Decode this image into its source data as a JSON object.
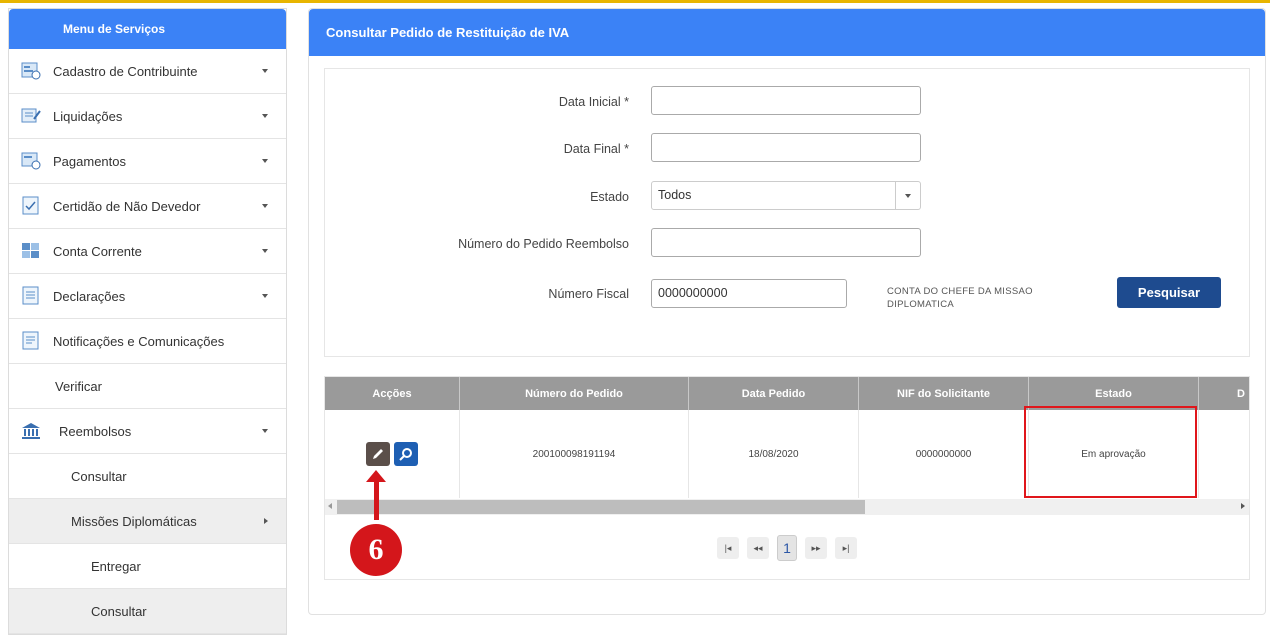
{
  "sidebar": {
    "title": "Menu de Serviços",
    "items": [
      {
        "label": "Cadastro de Contribuinte",
        "icon": "form-icon"
      },
      {
        "label": "Liquidações",
        "icon": "document-edit-icon"
      },
      {
        "label": "Pagamentos",
        "icon": "payment-icon"
      },
      {
        "label": "Certidão de Não Devedor",
        "icon": "certificate-icon"
      },
      {
        "label": "Conta Corrente",
        "icon": "account-icon"
      },
      {
        "label": "Declarações",
        "icon": "declaration-icon"
      },
      {
        "label": "Notificações e Comunicações",
        "icon": "notification-icon"
      },
      {
        "label": "Verificar"
      },
      {
        "label": "Reembolsos",
        "icon": "bank-icon"
      },
      {
        "label": "Consultar"
      },
      {
        "label": "Missões Diplomáticas"
      },
      {
        "label": "Entregar"
      },
      {
        "label": "Consultar"
      }
    ]
  },
  "panel": {
    "title": "Consultar Pedido de Restituição de IVA"
  },
  "form": {
    "data_inicial_label": "Data Inicial *",
    "data_inicial_value": "",
    "data_final_label": "Data Final *",
    "data_final_value": "",
    "estado_label": "Estado",
    "estado_value": "Todos",
    "numero_pedido_label": "Número do Pedido Reembolso",
    "numero_pedido_value": "",
    "numero_fiscal_label": "Número Fiscal",
    "numero_fiscal_value": "0000000000",
    "conta_note": "CONTA DO CHEFE DA MISSAO DIPLOMATICA",
    "search_button": "Pesquisar"
  },
  "table": {
    "columns": [
      "Acções",
      "Número do Pedido",
      "Data Pedido",
      "NIF do Solicitante",
      "Estado",
      "D"
    ],
    "rows": [
      {
        "numero": "200100098191194",
        "data": "18/08/2020",
        "nif": "0000000000",
        "estado": "Em aprovação"
      }
    ]
  },
  "pager": {
    "first": "|◂",
    "prev": "◂◂",
    "current": "1",
    "next": "▸▸",
    "last": "▸|"
  },
  "annotation": {
    "step_number": "6",
    "color": "#d4161b"
  },
  "colors": {
    "header_blue": "#3b82f6",
    "button_navy": "#1e4b8f",
    "table_header_grey": "#9a9a9a"
  }
}
